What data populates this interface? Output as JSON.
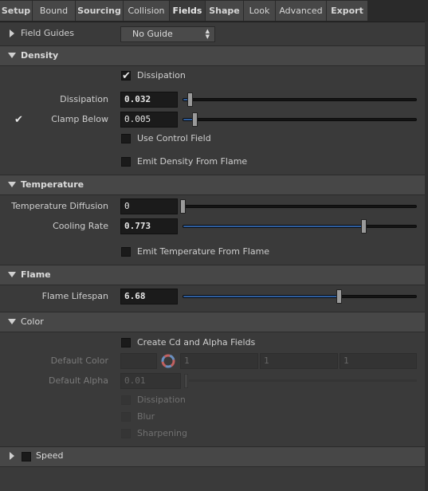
{
  "tabs": [
    "Setup",
    "Bound",
    "Sourcing",
    "Collision",
    "Fields",
    "Shape",
    "Look",
    "Advanced",
    "Export"
  ],
  "active_tab": "Fields",
  "field_guides": {
    "label": "Field Guides",
    "value": "No Guide"
  },
  "density": {
    "title": "Density",
    "dissipation_toggle_label": "Dissipation",
    "dissipation_label": "Dissipation",
    "dissipation_value": "0.032",
    "dissipation_fraction": 0.032,
    "clamp_below_label": "Clamp Below",
    "clamp_below_value": "0.005",
    "clamp_below_fraction": 0.05,
    "use_control_field_label": "Use Control Field",
    "emit_density_label": "Emit Density From Flame"
  },
  "temperature": {
    "title": "Temperature",
    "diffusion_label": "Temperature Diffusion",
    "diffusion_value": "0",
    "diffusion_fraction": 0,
    "cooling_rate_label": "Cooling Rate",
    "cooling_rate_value": "0.773",
    "cooling_rate_fraction": 0.773,
    "emit_temperature_label": "Emit Temperature From Flame"
  },
  "flame": {
    "title": "Flame",
    "lifespan_label": "Flame Lifespan",
    "lifespan_value": "6.68",
    "lifespan_fraction": 0.668
  },
  "color": {
    "title": "Color",
    "create_cd_label": "Create Cd and Alpha Fields",
    "default_color_label": "Default Color",
    "default_color_values": [
      "1",
      "1",
      "1"
    ],
    "default_alpha_label": "Default Alpha",
    "default_alpha_value": "0.01",
    "dissipation_label": "Dissipation",
    "blur_label": "Blur",
    "sharpening_label": "Sharpening"
  },
  "speed": {
    "label": "Speed"
  },
  "colors": {
    "accent_fill": "#2f5e9e",
    "panel_bg": "#3a3a3a",
    "section_bg": "#474747"
  }
}
